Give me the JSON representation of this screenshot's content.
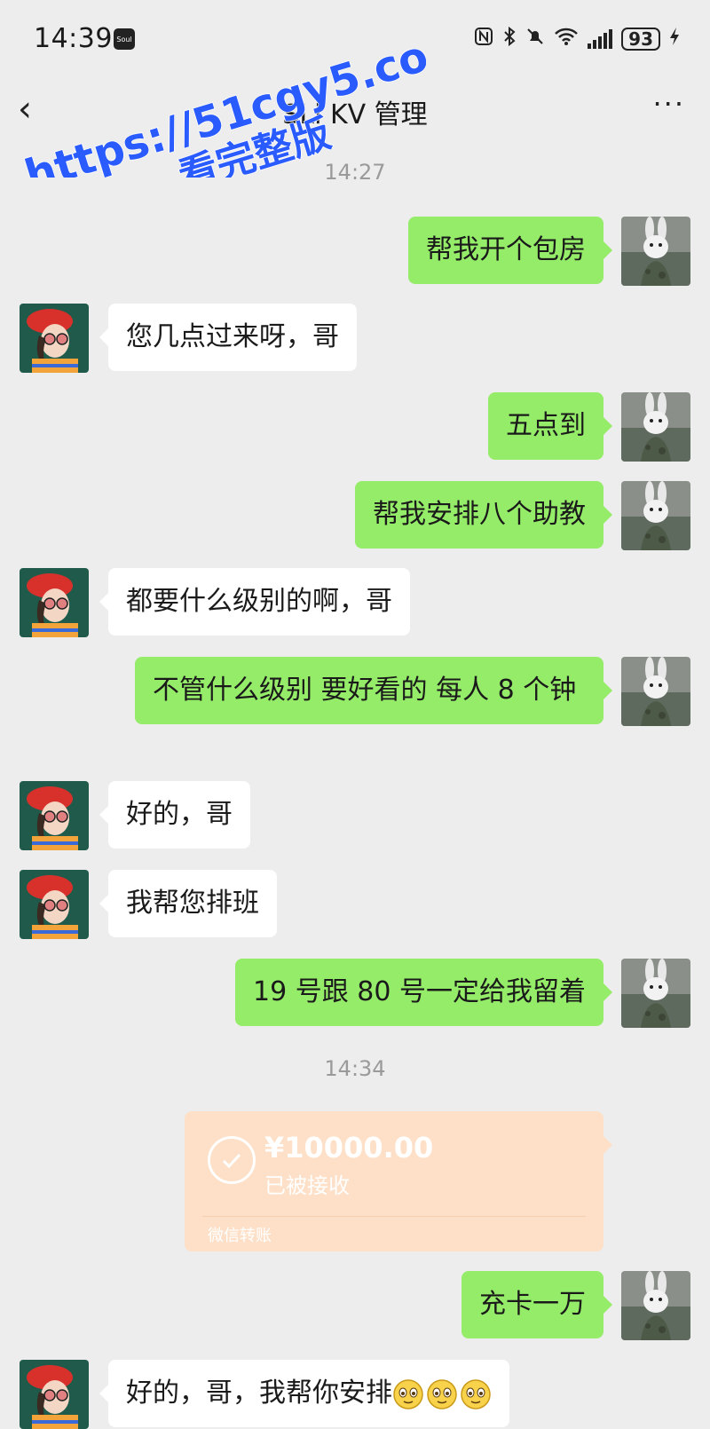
{
  "status_bar": {
    "time": "14:39",
    "app_badge": "Soul",
    "battery": "93"
  },
  "header": {
    "back_icon": "‹",
    "title": "SLi KV 管理",
    "more_icon": "···"
  },
  "watermark": {
    "line1": "https://51cgy5.com",
    "line2": "看完整版"
  },
  "timestamps": [
    "14:27",
    "14:34"
  ],
  "messages": [
    {
      "side": "out",
      "text": "帮我开个包房"
    },
    {
      "side": "in",
      "text": "您几点过来呀，哥"
    },
    {
      "side": "out",
      "text": "五点到"
    },
    {
      "side": "out",
      "text": "帮我安排八个助教"
    },
    {
      "side": "in",
      "text": "都要什么级别的啊，哥"
    },
    {
      "side": "out",
      "text": "不管什么级别 要好看的 每人 8 个钟"
    },
    {
      "side": "in",
      "text": "好的，哥"
    },
    {
      "side": "in",
      "text": "我帮您排班"
    },
    {
      "side": "out",
      "text": "19 号跟 80 号一定给我留着"
    },
    {
      "side": "out",
      "text": "充卡一万"
    },
    {
      "side": "in",
      "text": "好的，哥，我帮你安排"
    }
  ],
  "transfer": {
    "amount": "¥10000.00",
    "status": "已被接收",
    "footer": "微信转账"
  },
  "colors": {
    "background": "#ededed",
    "bubble_out": "#95ec69",
    "bubble_in": "#ffffff",
    "transfer_bg": "#fde0c7",
    "watermark": "#2a5bff"
  }
}
